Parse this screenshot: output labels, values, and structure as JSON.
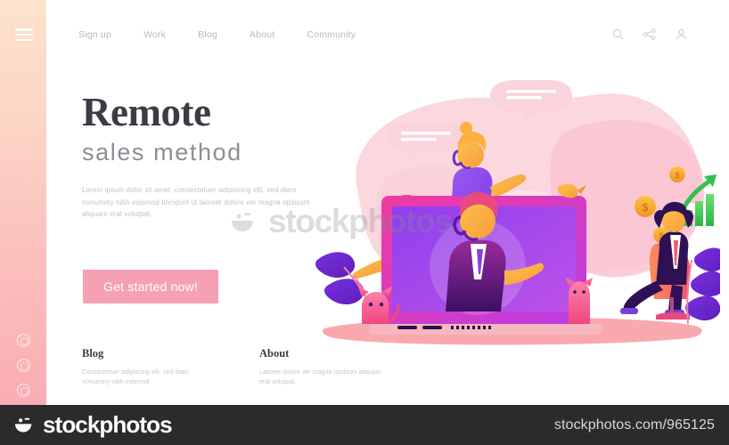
{
  "sidebar": {
    "menu_icon": "hamburger-icon",
    "social_dots": [
      "social-dot-1",
      "social-dot-2",
      "social-dot-3"
    ]
  },
  "nav": {
    "links": [
      {
        "label": "Sign up"
      },
      {
        "label": "Work"
      },
      {
        "label": "Blog"
      },
      {
        "label": "About"
      },
      {
        "label": "Community"
      }
    ],
    "icons": [
      "search-icon",
      "share-icon",
      "user-icon"
    ]
  },
  "hero": {
    "title": "Remote",
    "subtitle": "sales method",
    "body": "Lorem ipsum dolor sit amet, consectetuer adipiscing elit, sed diam nonummy nibh euismod tincidunt ut laoreet dolore ver magna opsisum aliquam erat volutpat.",
    "cta_label": "Get started now!"
  },
  "footer_columns": [
    {
      "title": "Blog",
      "body": "Consectetuer adipiscing elit, sed diam nonummy nibh euismod."
    },
    {
      "title": "About",
      "body": "Laoreet dolore ver magna opsisum aliquam erat volutpat."
    }
  ],
  "illustration": {
    "alt": "Remote sales method — call center agents with headsets around a laptop, coins, growth chart",
    "coin_symbol": "$"
  },
  "watermark": {
    "text": "stockphotos"
  },
  "bottom_bar": {
    "brand": "stockphotos",
    "url": "stockphotos.com/965125"
  },
  "colors": {
    "cta_pink": "#F6A0B4",
    "sidebar_top": "#FDE3CC",
    "sidebar_bottom": "#FAACB4",
    "heading_dark": "#3C3C46",
    "bar_dark": "#2B2B2D",
    "accent_purple": "#8B3DEB",
    "accent_magenta": "#E8369C",
    "coin_gold": "#F5A623",
    "chart_green": "#3DD13D"
  }
}
